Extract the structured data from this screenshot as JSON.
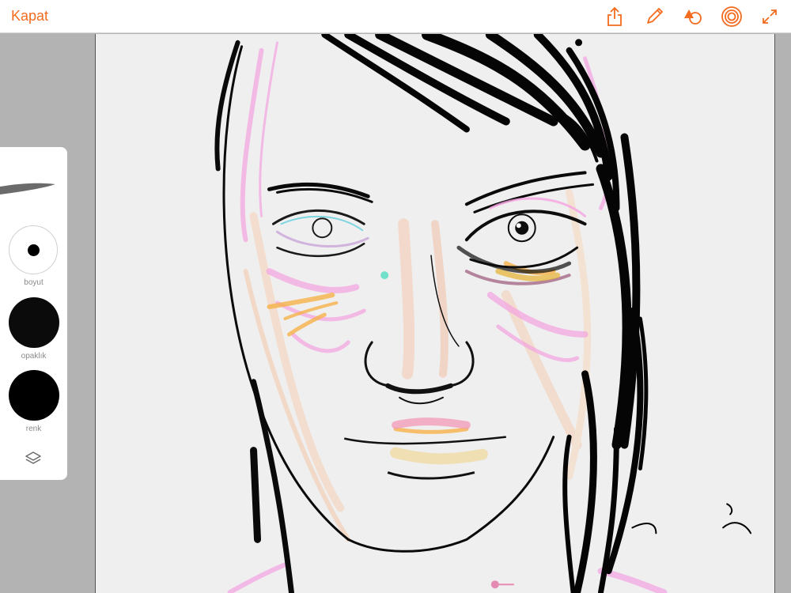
{
  "topbar": {
    "close_label": "Kapat",
    "tools": [
      "share-icon",
      "pencil-icon",
      "shapes-icon",
      "target-icon",
      "expand-icon"
    ],
    "accent": "#f26b1f"
  },
  "panel": {
    "size_label": "boyut",
    "opacity_label": "opaklık",
    "color_label": "renk",
    "current_color": "#000000",
    "layers_icon": "layers-icon"
  },
  "canvas": {
    "background": "#efefef",
    "content": "drawing"
  }
}
